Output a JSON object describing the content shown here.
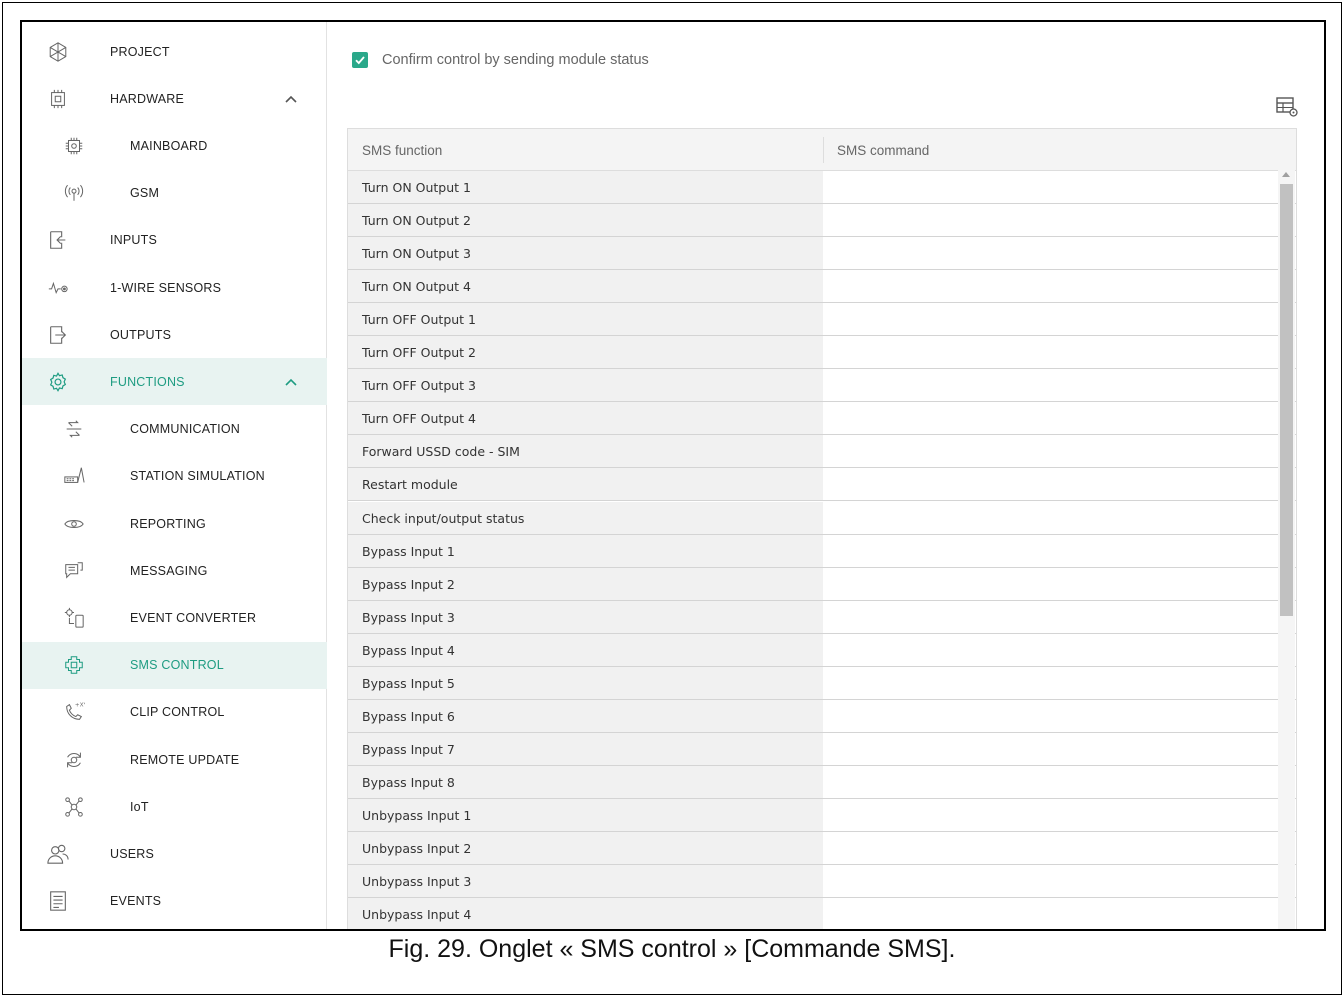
{
  "sidebar": {
    "items": [
      {
        "label": "PROJECT",
        "icon": "project-icon",
        "level": "top"
      },
      {
        "label": "HARDWARE",
        "icon": "hardware-icon",
        "level": "top",
        "expanded": true
      },
      {
        "label": "MAINBOARD",
        "icon": "mainboard-icon",
        "level": "sub"
      },
      {
        "label": "GSM",
        "icon": "gsm-icon",
        "level": "sub"
      },
      {
        "label": "INPUTS",
        "icon": "inputs-icon",
        "level": "top"
      },
      {
        "label": "1-WIRE SENSORS",
        "icon": "sensor-icon",
        "level": "top"
      },
      {
        "label": "OUTPUTS",
        "icon": "outputs-icon",
        "level": "top"
      },
      {
        "label": "FUNCTIONS",
        "icon": "gear-icon",
        "level": "top",
        "expanded": true,
        "active": true
      },
      {
        "label": "COMMUNICATION",
        "icon": "communication-icon",
        "level": "sub"
      },
      {
        "label": "STATION SIMULATION",
        "icon": "station-icon",
        "level": "sub"
      },
      {
        "label": "REPORTING",
        "icon": "eye-icon",
        "level": "sub"
      },
      {
        "label": "MESSAGING",
        "icon": "message-icon",
        "level": "sub"
      },
      {
        "label": "EVENT CONVERTER",
        "icon": "converter-icon",
        "level": "sub"
      },
      {
        "label": "SMS CONTROL",
        "icon": "sms-control-icon",
        "level": "sub",
        "selected": true
      },
      {
        "label": "CLIP CONTROL",
        "icon": "phone-icon",
        "level": "sub"
      },
      {
        "label": "REMOTE UPDATE",
        "icon": "refresh-icon",
        "level": "sub"
      },
      {
        "label": "IoT",
        "icon": "network-icon",
        "level": "sub"
      },
      {
        "label": "USERS",
        "icon": "users-icon",
        "level": "top"
      },
      {
        "label": "EVENTS",
        "icon": "events-icon",
        "level": "top"
      }
    ]
  },
  "content": {
    "confirm_label": "Confirm control by sending module status",
    "confirm_checked": true,
    "table": {
      "headers": [
        "SMS function",
        "SMS command"
      ],
      "rows": [
        {
          "function": "Turn ON Output 1",
          "command": ""
        },
        {
          "function": "Turn ON Output 2",
          "command": ""
        },
        {
          "function": "Turn ON Output 3",
          "command": ""
        },
        {
          "function": "Turn ON Output 4",
          "command": ""
        },
        {
          "function": "Turn OFF Output 1",
          "command": ""
        },
        {
          "function": "Turn OFF Output 2",
          "command": ""
        },
        {
          "function": "Turn OFF Output 3",
          "command": ""
        },
        {
          "function": "Turn OFF Output 4",
          "command": ""
        },
        {
          "function": "Forward USSD code - SIM",
          "command": ""
        },
        {
          "function": "Restart module",
          "command": ""
        },
        {
          "function": "Check input/output status",
          "command": ""
        },
        {
          "function": "Bypass Input 1",
          "command": ""
        },
        {
          "function": "Bypass Input 2",
          "command": ""
        },
        {
          "function": "Bypass Input 3",
          "command": ""
        },
        {
          "function": "Bypass Input 4",
          "command": ""
        },
        {
          "function": "Bypass Input 5",
          "command": ""
        },
        {
          "function": "Bypass Input 6",
          "command": ""
        },
        {
          "function": "Bypass Input 7",
          "command": ""
        },
        {
          "function": "Bypass Input 8",
          "command": ""
        },
        {
          "function": "Unbypass Input 1",
          "command": ""
        },
        {
          "function": "Unbypass Input 2",
          "command": ""
        },
        {
          "function": "Unbypass Input 3",
          "command": ""
        },
        {
          "function": "Unbypass Input 4",
          "command": ""
        }
      ]
    }
  },
  "caption": "Fig. 29. Onglet « SMS control » [Commande SMS].",
  "colors": {
    "accent": "#1e9c82",
    "active_bg": "#e8f3f1",
    "checkbox": "#2aa88a"
  }
}
